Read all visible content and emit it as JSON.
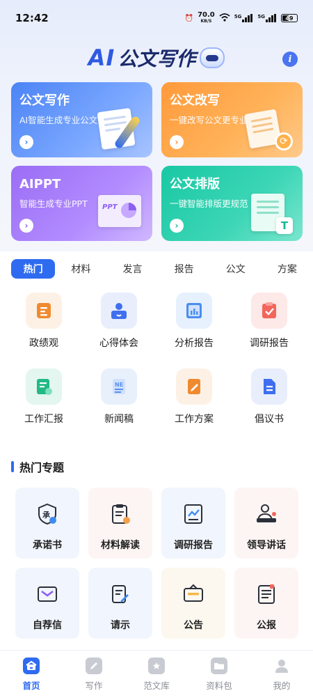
{
  "status_bar": {
    "time": "12:42",
    "network_speed": "70.0",
    "network_unit": "KB/S",
    "signal_1": "5G",
    "signal_2": "5G",
    "battery": "49"
  },
  "header": {
    "logo_ai": "AI",
    "logo_text": "公文写作",
    "info_icon": "info-icon"
  },
  "feature_cards": [
    {
      "title": "公文写作",
      "subtitle": "AI智能生成专业公文",
      "icon": "pen-document-icon"
    },
    {
      "title": "公文改写",
      "subtitle": "一键改写公文更专业",
      "icon": "rewrite-document-icon"
    },
    {
      "title": "AIPPT",
      "subtitle": "智能生成专业PPT",
      "icon": "ppt-chart-icon",
      "art_text": "PPT"
    },
    {
      "title": "公文排版",
      "subtitle": "一键智能排版更规范",
      "icon": "layout-document-icon",
      "art_text": "T"
    }
  ],
  "category_tabs": [
    "热门",
    "材料",
    "发言",
    "报告",
    "公文",
    "方案"
  ],
  "templates": [
    {
      "label": "政绩观",
      "icon": "list-icon",
      "color": "#f08a2e",
      "bg": "#fdf1e6"
    },
    {
      "label": "心得体会",
      "icon": "person-book-icon",
      "color": "#3f6ff0",
      "bg": "#e8eefc"
    },
    {
      "label": "分析报告",
      "icon": "chart-report-icon",
      "color": "#4a8ef0",
      "bg": "#e6f1fd"
    },
    {
      "label": "调研报告",
      "icon": "clipboard-check-icon",
      "color": "#f2665c",
      "bg": "#fde9e7"
    },
    {
      "label": "工作汇报",
      "icon": "report-edit-icon",
      "color": "#22b985",
      "bg": "#e3f6ef"
    },
    {
      "label": "新闻稿",
      "icon": "news-icon",
      "color": "#5a8ff0",
      "bg": "#e8f0fc"
    },
    {
      "label": "工作方案",
      "icon": "plan-edit-icon",
      "color": "#f08a2e",
      "bg": "#fdf1e6"
    },
    {
      "label": "倡议书",
      "icon": "document-icon",
      "color": "#3f6ff0",
      "bg": "#e8eefc"
    }
  ],
  "hot_topics": {
    "title": "热门专题",
    "items": [
      {
        "label": "承诺书",
        "icon": "pledge-shield-icon",
        "icon_text": "承",
        "bg": "#f1f5fd"
      },
      {
        "label": "材料解读",
        "icon": "clipboard-check-icon",
        "bg": "#fdf5f3"
      },
      {
        "label": "调研报告",
        "icon": "chart-report-icon",
        "bg": "#f1f5fd"
      },
      {
        "label": "领导讲话",
        "icon": "speaker-icon",
        "bg": "#fdf5f3"
      },
      {
        "label": "自荐信",
        "icon": "envelope-icon",
        "bg": "#f1f5fd"
      },
      {
        "label": "请示",
        "icon": "request-edit-icon",
        "bg": "#f1f5fd"
      },
      {
        "label": "公告",
        "icon": "notice-icon",
        "bg": "#fdf8ef"
      },
      {
        "label": "公报",
        "icon": "bulletin-icon",
        "bg": "#fdf5f3"
      }
    ]
  },
  "bottom_nav": [
    {
      "label": "首页",
      "icon": "home-icon",
      "active": true
    },
    {
      "label": "写作",
      "icon": "write-icon",
      "active": false
    },
    {
      "label": "范文库",
      "icon": "library-icon",
      "active": false
    },
    {
      "label": "资料包",
      "icon": "folder-icon",
      "active": false
    },
    {
      "label": "我的",
      "icon": "user-icon",
      "active": false
    }
  ],
  "colors": {
    "accent": "#2e6bf0",
    "card_blue": "#4c84f5",
    "card_orange": "#ff9a3c",
    "card_purple": "#9b6df5",
    "card_teal": "#19c8a4"
  }
}
